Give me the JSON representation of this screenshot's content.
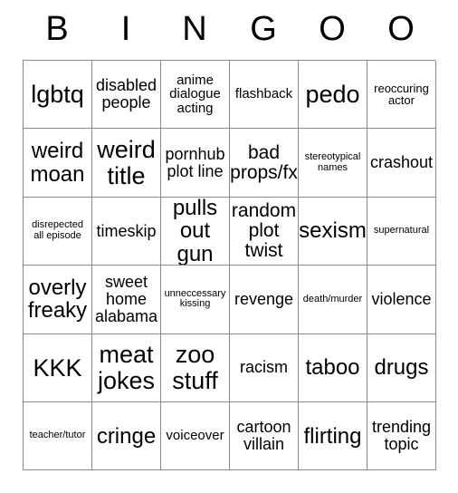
{
  "card": {
    "header_letters": [
      "B",
      "I",
      "N",
      "G",
      "O",
      "O"
    ],
    "columns": 6,
    "rows": 6,
    "grid_color": "#8a8a8a",
    "text_color": "#000000",
    "background_color": "#ffffff",
    "cells": [
      {
        "text": "lgbtq",
        "size": "xxl"
      },
      {
        "text": "disabled people",
        "size": "md"
      },
      {
        "text": "anime dialogue acting",
        "size": "sm"
      },
      {
        "text": "flashback",
        "size": "sm"
      },
      {
        "text": "pedo",
        "size": "xxl"
      },
      {
        "text": "reoccuring actor",
        "size": "xs"
      },
      {
        "text": "weird moan",
        "size": "xl"
      },
      {
        "text": "weird title",
        "size": "xxl"
      },
      {
        "text": "pornhub plot line",
        "size": "md"
      },
      {
        "text": "bad props/fx",
        "size": "lg"
      },
      {
        "text": "stereotypical names",
        "size": "xxs"
      },
      {
        "text": "crashout",
        "size": "md"
      },
      {
        "text": "disrepected all episode",
        "size": "xxs"
      },
      {
        "text": "timeskip",
        "size": "md"
      },
      {
        "text": "pulls out gun",
        "size": "xl"
      },
      {
        "text": "random plot twist",
        "size": "lg"
      },
      {
        "text": "sexism",
        "size": "xl"
      },
      {
        "text": "supernatural",
        "size": "xxs"
      },
      {
        "text": "overly freaky",
        "size": "xl"
      },
      {
        "text": "sweet home alabama",
        "size": "md"
      },
      {
        "text": "unneccessary kissing",
        "size": "xxs"
      },
      {
        "text": "revenge",
        "size": "md"
      },
      {
        "text": "death/murder",
        "size": "xxs"
      },
      {
        "text": "violence",
        "size": "md"
      },
      {
        "text": "KKK",
        "size": "xxl"
      },
      {
        "text": "meat jokes",
        "size": "xxl"
      },
      {
        "text": "zoo stuff",
        "size": "xxl"
      },
      {
        "text": "racism",
        "size": "md"
      },
      {
        "text": "taboo",
        "size": "xl"
      },
      {
        "text": "drugs",
        "size": "xl"
      },
      {
        "text": "teacher/tutor",
        "size": "xxs"
      },
      {
        "text": "cringe",
        "size": "xl"
      },
      {
        "text": "voiceover",
        "size": "sm"
      },
      {
        "text": "cartoon villain",
        "size": "md"
      },
      {
        "text": "flirting",
        "size": "xl"
      },
      {
        "text": "trending topic",
        "size": "md"
      }
    ]
  }
}
